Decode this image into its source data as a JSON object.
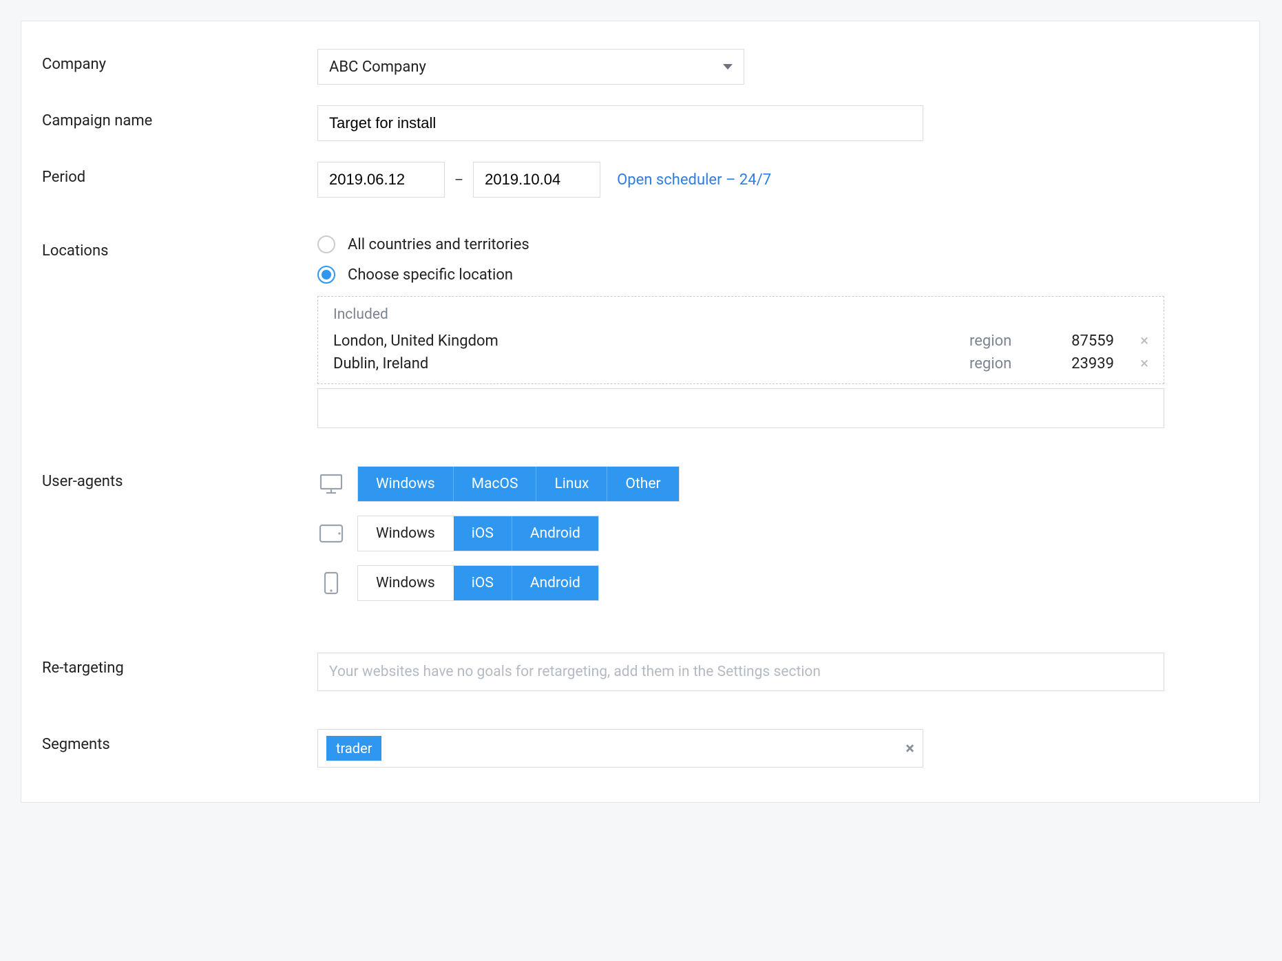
{
  "labels": {
    "company": "Company",
    "campaign_name": "Campaign name",
    "period": "Period",
    "locations": "Locations",
    "user_agents": "User-agents",
    "retargeting": "Re-targeting",
    "segments": "Segments"
  },
  "company": {
    "value": "ABC Company"
  },
  "campaign_name": {
    "value": "Target for install"
  },
  "period": {
    "start": "2019.06.12",
    "end": "2019.10.04",
    "dash": "–",
    "scheduler_link": "Open scheduler – 24/7"
  },
  "locations": {
    "option_all": "All countries and territories",
    "option_specific": "Choose specific location",
    "selected": "specific",
    "included_label": "Included",
    "items": [
      {
        "name": "London, United Kingdom",
        "type": "region",
        "count": "87559"
      },
      {
        "name": "Dublin, Ireland",
        "type": "region",
        "count": "23939"
      }
    ]
  },
  "user_agents": {
    "desktop": [
      {
        "label": "Windows",
        "active": true
      },
      {
        "label": "MacOS",
        "active": true
      },
      {
        "label": "Linux",
        "active": true
      },
      {
        "label": "Other",
        "active": true
      }
    ],
    "tablet": [
      {
        "label": "Windows",
        "active": false
      },
      {
        "label": "iOS",
        "active": true
      },
      {
        "label": "Android",
        "active": true
      }
    ],
    "mobile": [
      {
        "label": "Windows",
        "active": false
      },
      {
        "label": "iOS",
        "active": true
      },
      {
        "label": "Android",
        "active": true
      }
    ]
  },
  "retargeting": {
    "placeholder": "Your websites have no goals for retargeting, add them in the Settings section"
  },
  "segments": {
    "tags": [
      "trader"
    ]
  }
}
